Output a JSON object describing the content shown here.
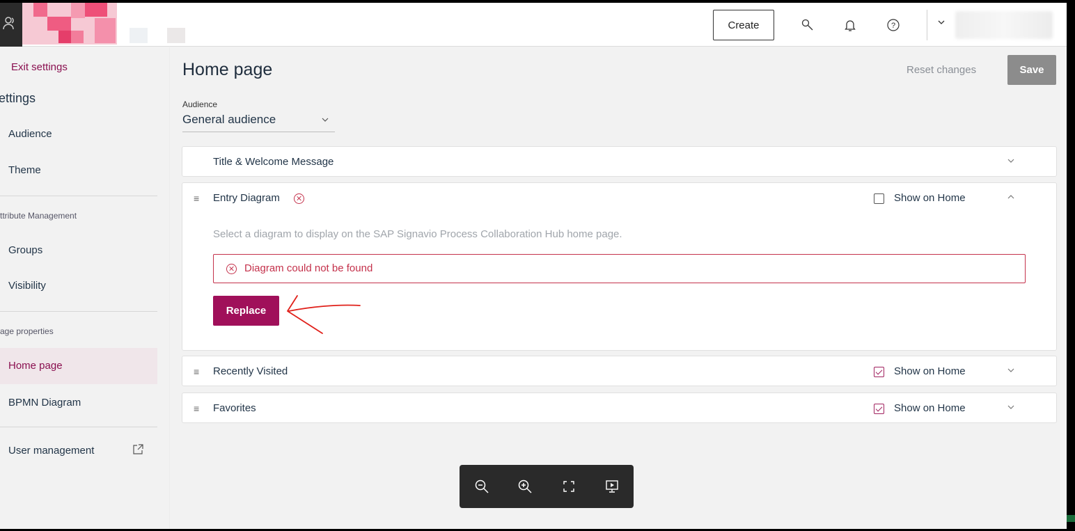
{
  "topbar": {
    "create_label": "Create",
    "icons": [
      "search-icon",
      "bell-icon",
      "help-icon",
      "chevron-down-icon"
    ]
  },
  "sidebar": {
    "exit_label": "Exit settings",
    "heading": "ettings",
    "items_top": [
      {
        "label": "Audience"
      },
      {
        "label": "Theme"
      }
    ],
    "section_attr": "ttribute Management",
    "items_attr": [
      {
        "label": "Groups"
      },
      {
        "label": "Visibility"
      }
    ],
    "section_page": "age properties",
    "items_page": [
      {
        "label": "Home page",
        "active": true
      },
      {
        "label": "BPMN Diagram"
      }
    ],
    "user_mgmt_label": "User management"
  },
  "main": {
    "title": "Home page",
    "reset_label": "Reset changes",
    "save_label": "Save",
    "audience": {
      "label": "Audience",
      "value": "General audience"
    },
    "panels": [
      {
        "title": "Title & Welcome Message",
        "expanded": false
      },
      {
        "title": "Entry Diagram",
        "expanded": true,
        "show_on_home": false,
        "show_label": "Show on Home",
        "description": "Select a diagram to display on the SAP Signavio Process Collaboration Hub home page.",
        "error": "Diagram could not be found",
        "replace_label": "Replace"
      },
      {
        "title": "Recently Visited",
        "show_on_home": true,
        "show_label": "Show on Home"
      },
      {
        "title": "Favorites",
        "show_on_home": true,
        "show_label": "Show on Home"
      }
    ]
  },
  "zoombar": {
    "icons": [
      "zoom-out-icon",
      "zoom-in-icon",
      "fit-screen-icon",
      "presentation-icon"
    ]
  },
  "colors": {
    "accent": "#a0105a",
    "error": "#c4314b",
    "annotation": "#e0201a"
  }
}
